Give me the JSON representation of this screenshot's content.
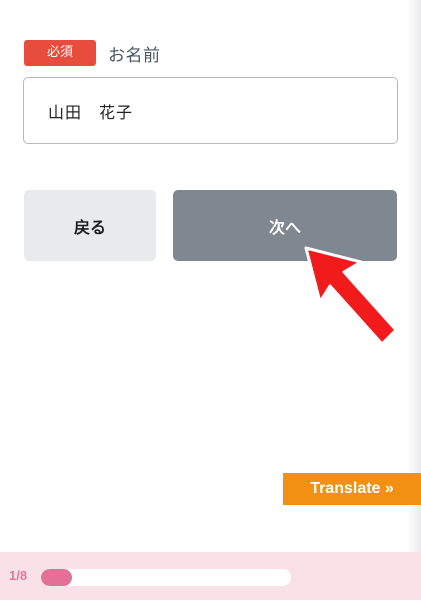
{
  "form": {
    "required_badge": "必須",
    "name_label": "お名前",
    "name_value": "山田　花子"
  },
  "buttons": {
    "back": "戻る",
    "next": "次へ"
  },
  "translate_widget": {
    "label": "Translate »"
  },
  "progress": {
    "label": "1/8",
    "fraction": 0.125
  },
  "colors": {
    "required_badge": "#e84c3d",
    "next_button": "#7f8790",
    "back_button": "#e9eaec",
    "arrow": "#f21b1b",
    "translate": "#f29111",
    "progress_fill": "#e46f97",
    "footer_bg": "#fae0e7"
  }
}
